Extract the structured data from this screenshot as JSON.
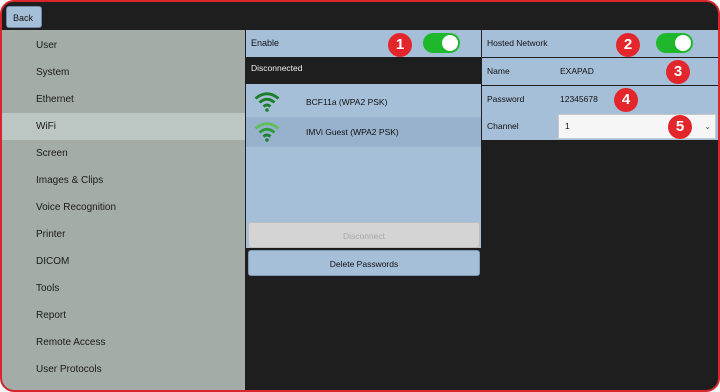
{
  "topbar": {
    "back_label": "Back"
  },
  "sidebar": {
    "items": [
      {
        "label": "User"
      },
      {
        "label": "System"
      },
      {
        "label": "Ethernet"
      },
      {
        "label": "WiFi"
      },
      {
        "label": "Screen"
      },
      {
        "label": "Images & Clips"
      },
      {
        "label": "Voice Recognition"
      },
      {
        "label": "Printer"
      },
      {
        "label": "DICOM"
      },
      {
        "label": "Tools"
      },
      {
        "label": "Report"
      },
      {
        "label": "Remote Access"
      },
      {
        "label": "User Protocols"
      }
    ],
    "active": "WiFi"
  },
  "wifi": {
    "enable_label": "Enable",
    "enabled": true,
    "status": "Disconnected",
    "networks": [
      {
        "name": "BCF11a (WPA2 PSK)",
        "icon": "wifi-signal-icon"
      },
      {
        "name": "IMVi Guest (WPA2 PSK)",
        "icon": "wifi-signal-icon"
      }
    ],
    "disconnect_label": "Disconnect",
    "delete_label": "Delete Passwords"
  },
  "hosted": {
    "title": "Hosted Network",
    "enabled": true,
    "name_label": "Name",
    "name_value": "EXAPAD",
    "password_label": "Password",
    "password_value": "12345678",
    "channel_label": "Channel",
    "channel_value": "1"
  },
  "badges": [
    "1",
    "2",
    "3",
    "4",
    "5"
  ],
  "colors": {
    "accent": "#1fb82d",
    "badge": "#e3262b",
    "panel": "#a6bfd9",
    "frame": "#d8262c"
  }
}
